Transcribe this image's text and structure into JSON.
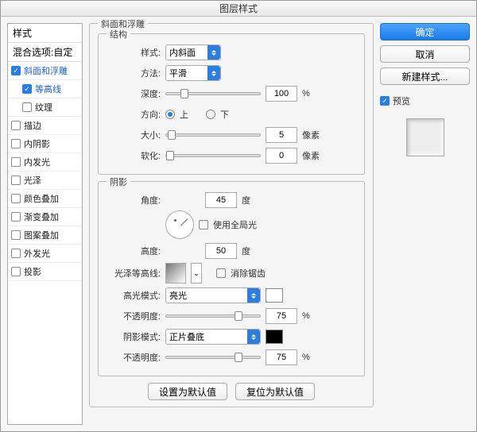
{
  "title": "图层样式",
  "sidebar": {
    "header": "样式",
    "blendOptions": "混合选项:自定",
    "items": [
      {
        "label": "斜面和浮雕",
        "checked": true,
        "indent": false,
        "highlight": true
      },
      {
        "label": "等高线",
        "checked": true,
        "indent": true,
        "highlight": false
      },
      {
        "label": "纹理",
        "checked": false,
        "indent": true,
        "highlight": false
      },
      {
        "label": "描边",
        "checked": false,
        "indent": false,
        "highlight": false
      },
      {
        "label": "内阴影",
        "checked": false,
        "indent": false,
        "highlight": false
      },
      {
        "label": "内发光",
        "checked": false,
        "indent": false,
        "highlight": false
      },
      {
        "label": "光泽",
        "checked": false,
        "indent": false,
        "highlight": false
      },
      {
        "label": "颜色叠加",
        "checked": false,
        "indent": false,
        "highlight": false
      },
      {
        "label": "渐变叠加",
        "checked": false,
        "indent": false,
        "highlight": false
      },
      {
        "label": "图案叠加",
        "checked": false,
        "indent": false,
        "highlight": false
      },
      {
        "label": "外发光",
        "checked": false,
        "indent": false,
        "highlight": false
      },
      {
        "label": "投影",
        "checked": false,
        "indent": false,
        "highlight": false
      }
    ]
  },
  "panel": {
    "bevel": {
      "title": "斜面和浮雕",
      "structure": {
        "title": "结构",
        "styleLabel": "样式:",
        "styleValue": "内斜面",
        "techniqueLabel": "方法:",
        "techniqueValue": "平滑",
        "depthLabel": "深度:",
        "depthValue": "100",
        "depthUnit": "%",
        "directionLabel": "方向:",
        "upLabel": "上",
        "downLabel": "下",
        "sizeLabel": "大小:",
        "sizeValue": "5",
        "sizeUnit": "像素",
        "softenLabel": "软化:",
        "softenValue": "0",
        "softenUnit": "像素"
      },
      "shading": {
        "title": "阴影",
        "angleLabel": "角度:",
        "angleValue": "45",
        "angleUnit": "度",
        "globalLightLabel": "使用全局光",
        "altitudeLabel": "高度:",
        "altitudeValue": "50",
        "altitudeUnit": "度",
        "glossContourLabel": "光泽等高线:",
        "antiAliasedLabel": "消除锯齿",
        "highlightModeLabel": "高光模式:",
        "highlightModeValue": "亮光",
        "highlightColor": "#ffffff",
        "highlightOpacityLabel": "不透明度:",
        "highlightOpacityValue": "75",
        "opacityUnit": "%",
        "shadowModeLabel": "阴影模式:",
        "shadowModeValue": "正片叠底",
        "shadowColor": "#000000",
        "shadowOpacityLabel": "不透明度:",
        "shadowOpacityValue": "75"
      }
    },
    "bottom": {
      "setDefault": "设置为默认值",
      "resetDefault": "复位为默认值"
    }
  },
  "right": {
    "ok": "确定",
    "cancel": "取消",
    "newStyle": "新建样式...",
    "previewLabel": "预览"
  }
}
